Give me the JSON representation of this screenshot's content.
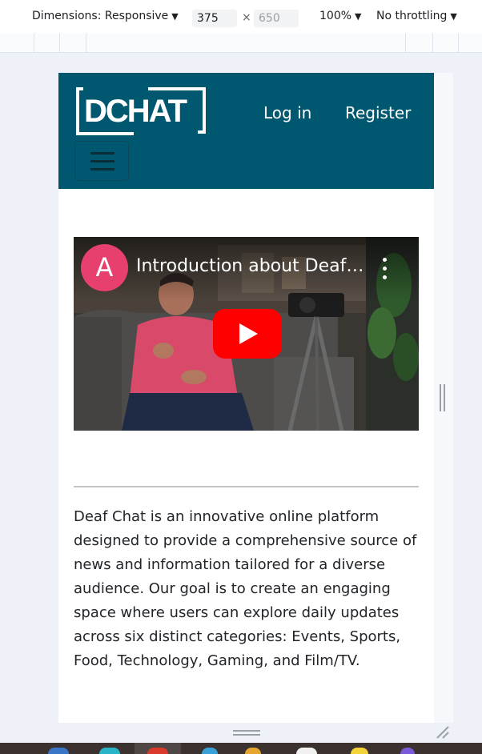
{
  "devtools": {
    "dimensions_label": "Dimensions: Responsive",
    "width_value": "375",
    "height_placeholder": "650",
    "times_symbol": "×",
    "zoom_label": "100%",
    "throttle_label": "No throttling",
    "caret": "▼"
  },
  "header": {
    "logo_text": "DCHAT",
    "login_label": "Log in",
    "register_label": "Register",
    "background_color": "#005870"
  },
  "video": {
    "channel_initial": "A",
    "title": "Introduction about DeafChat",
    "avatar_color": "#e8406e",
    "play_color": "#ff0000"
  },
  "content": {
    "intro_text": "Deaf Chat is an innovative online platform designed to provide a comprehensive source of news and information tailored for a diverse audience. Our goal is to create an engaging space where users can explore daily updates across six distinct categories: Events, Sports, Food, Technology, Gaming, and Film/TV."
  }
}
